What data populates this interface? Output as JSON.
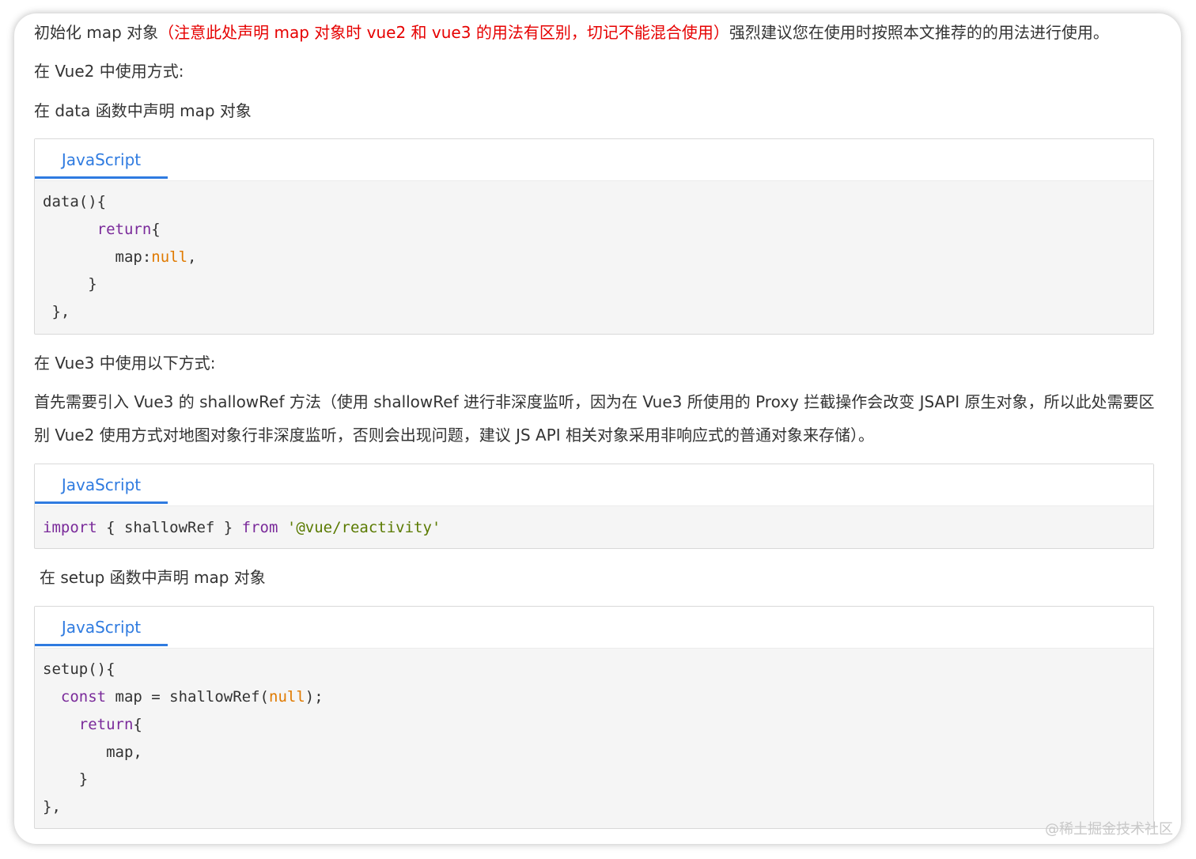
{
  "paragraphs": {
    "intro_prefix": "初始化 map 对象",
    "intro_warning": "（注意此处声明 map 对象时 vue2 和 vue3 的用法有区别，切记不能混合使用）",
    "intro_suffix": "强烈建议您在使用时按照本文推荐的的用法进行使用。",
    "vue2_heading": "在 Vue2 中使用方式:",
    "vue2_data": "在 data 函数中声明 map 对象",
    "vue3_heading": "在 Vue3 中使用以下方式:",
    "vue3_desc": "首先需要引入 Vue3 的 shallowRef 方法（使用 shallowRef 进行非深度监听，因为在 Vue3 所使用的 Proxy 拦截操作会改变 JSAPI 原生对象，所以此处需要区别 Vue2 使用方式对地图对象行非深度监听，否则会出现问题，建议 JS API 相关对象采用非响应式的普通对象来存储）。",
    "vue3_setup": "在 setup 函数中声明 map 对象"
  },
  "code_blocks": [
    {
      "language": "JavaScript",
      "lines": [
        [
          {
            "t": "data(){",
            "c": "plain"
          }
        ],
        [
          {
            "t": "      ",
            "c": "plain"
          },
          {
            "t": "return",
            "c": "kw"
          },
          {
            "t": "{",
            "c": "plain"
          }
        ],
        [
          {
            "t": "        map:",
            "c": "plain"
          },
          {
            "t": "null",
            "c": "lit"
          },
          {
            "t": ",",
            "c": "plain"
          }
        ],
        [
          {
            "t": "     }",
            "c": "plain"
          }
        ],
        [
          {
            "t": " },",
            "c": "plain"
          }
        ]
      ]
    },
    {
      "language": "JavaScript",
      "lines": [
        [
          {
            "t": "import",
            "c": "kw"
          },
          {
            "t": " { shallowRef } ",
            "c": "plain"
          },
          {
            "t": "from",
            "c": "kw"
          },
          {
            "t": " ",
            "c": "plain"
          },
          {
            "t": "'@vue/reactivity'",
            "c": "str"
          }
        ]
      ]
    },
    {
      "language": "JavaScript",
      "lines": [
        [
          {
            "t": "setup(){",
            "c": "plain"
          }
        ],
        [
          {
            "t": "  ",
            "c": "plain"
          },
          {
            "t": "const",
            "c": "kw"
          },
          {
            "t": " map = shallowRef(",
            "c": "plain"
          },
          {
            "t": "null",
            "c": "lit"
          },
          {
            "t": ");",
            "c": "plain"
          }
        ],
        [
          {
            "t": "    ",
            "c": "plain"
          },
          {
            "t": "return",
            "c": "kw"
          },
          {
            "t": "{",
            "c": "plain"
          }
        ],
        [
          {
            "t": "       map,",
            "c": "plain"
          }
        ],
        [
          {
            "t": "    }",
            "c": "plain"
          }
        ],
        [
          {
            "t": "},",
            "c": "plain"
          }
        ]
      ]
    }
  ],
  "watermark": "@稀土掘金技术社区",
  "colors": {
    "warning": "#e60000",
    "accent": "#2f7be0",
    "keyword": "#7a2a9a",
    "literal": "#e07a00",
    "string": "#5a7a00"
  }
}
